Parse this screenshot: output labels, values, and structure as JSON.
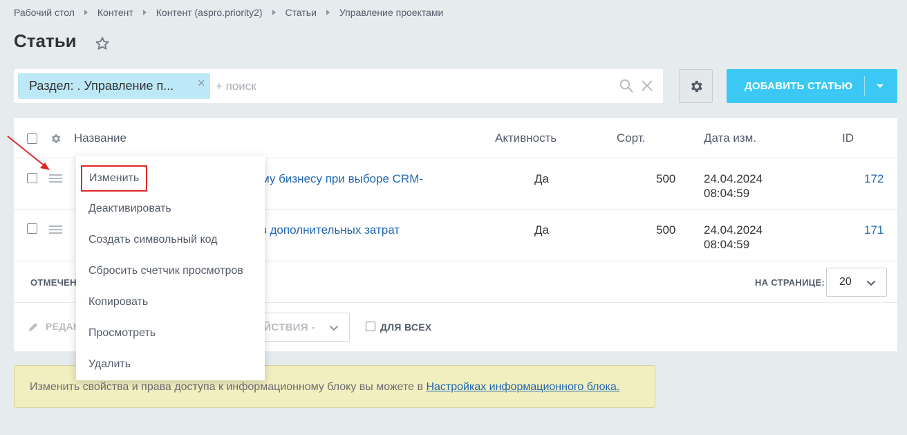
{
  "breadcrumb": [
    "Рабочий стол",
    "Контент",
    "Контент (aspro.priority2)",
    "Статьи",
    "Управление проектами"
  ],
  "page_title": "Статьи",
  "filter": {
    "chip_label": "Раздел: . Управление п...",
    "search_placeholder": "+ поиск"
  },
  "add_button": {
    "label": "ДОБАВИТЬ СТАТЬЮ"
  },
  "columns": [
    "Название",
    "Активность",
    "Сорт.",
    "Дата изм.",
    "ID"
  ],
  "rows": [
    {
      "name": "му бизнесу при выборе CRM-",
      "active": "Да",
      "sort": "500",
      "date": "24.04.2024",
      "time": "08:04:59",
      "id": "172"
    },
    {
      "name": "з дополнительных затрат",
      "active": "Да",
      "sort": "500",
      "date": "24.04.2024",
      "time": "08:04:59",
      "id": "171"
    }
  ],
  "footer": {
    "marked_label": "ОТМЕЧЕН",
    "per_page_label": "НА СТРАНИЦЕ:",
    "per_page_value": "20",
    "edit_label": "РЕДАК",
    "actions_label": "ЕЙСТВИЯ -",
    "for_all_label": "ДЛЯ ВСЕХ"
  },
  "info": {
    "text": "Изменить свойства и права доступа к информационному блоку вы можете в ",
    "link": "Настройках информационного блока."
  },
  "context_menu": [
    "Изменить",
    "Деактивировать",
    "Создать символьный код",
    "Сбросить счетчик просмотров",
    "Копировать",
    "Просмотреть",
    "Удалить"
  ],
  "colors": {
    "accent": "#3bc8f5",
    "link": "#2067b0",
    "highlight": "#e02727",
    "info_bg": "#f1eebf"
  }
}
